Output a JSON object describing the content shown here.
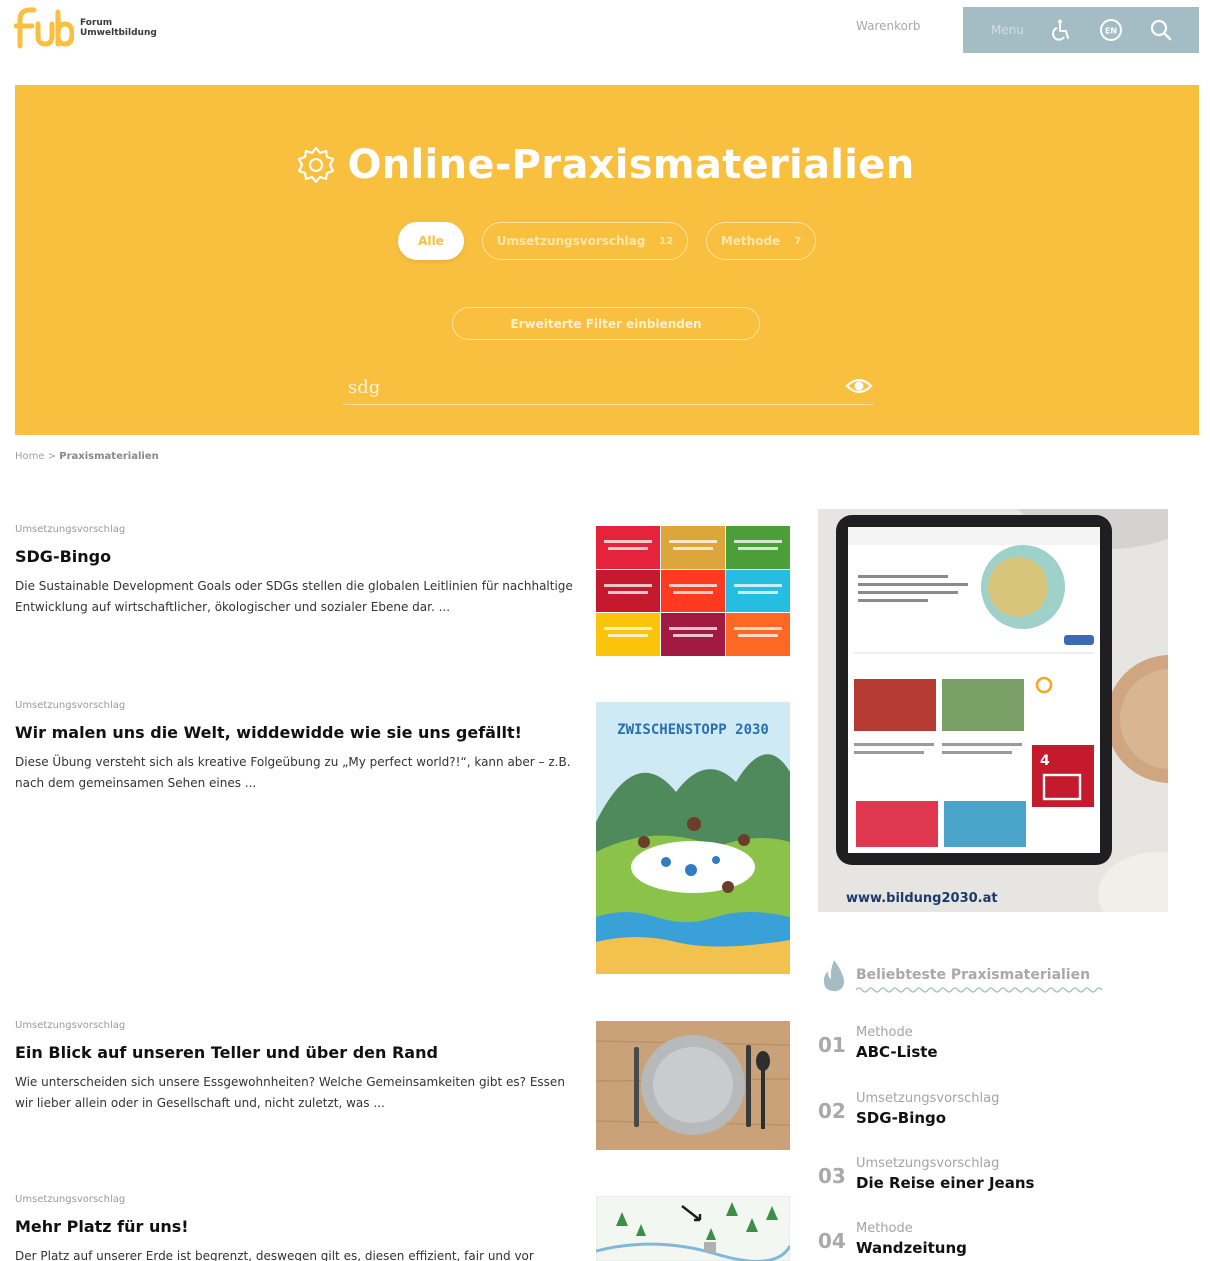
{
  "header": {
    "logo_text_line1": "Forum",
    "logo_text_line2": "Umweltbildung",
    "cart_label": "Warenkorb",
    "menu_label": "Menu",
    "accent_color": "#f9bf3f",
    "util_bar_color": "#a4bcc3"
  },
  "hero": {
    "title": "Online-Praxismaterialien",
    "tabs": [
      {
        "label": "Alle",
        "active": true
      },
      {
        "label": "Umsetzungsvorschlag",
        "count": "12"
      },
      {
        "label": "Methode",
        "count": "7"
      }
    ],
    "filter_button_label": "Erweiterte Filter einblenden",
    "search_value": "sdg"
  },
  "breadcrumb": {
    "home": "Home",
    "separator": ">",
    "current": "Praxismaterialien"
  },
  "articles": [
    {
      "category": "Umsetzungsvorschlag",
      "title": "SDG-Bingo",
      "excerpt": "Die Sustainable Development Goals oder SDGs stellen die globalen Leitlinien für nachhaltige Entwicklung auf wirtschaftlicher, ökologischer und sozialer Ebene dar. ..."
    },
    {
      "category": "Umsetzungsvorschlag",
      "title": "Wir malen uns die Welt, widdewidde wie sie uns gefällt!",
      "excerpt": "Diese Übung versteht sich als kreative Folgeübung zu „My perfect world?!“, kann aber – z.B. nach dem gemeinsamen Sehen eines ...",
      "image_text": "ZWISCHENSTOPP 2030"
    },
    {
      "category": "Umsetzungsvorschlag",
      "title": "Ein Blick auf unseren Teller und über den Rand",
      "excerpt": "Wie unterscheiden sich unsere Essgewohnheiten? Welche Gemeinsamkeiten gibt es? Essen wir lieber allein oder in Gesellschaft und, nicht zuletzt, was ..."
    },
    {
      "category": "Umsetzungsvorschlag",
      "title": "Mehr Platz für uns!",
      "excerpt": "Der Platz auf unserer Erde ist begrenzt, deswegen gilt es, diesen effizient, fair und vor"
    }
  ],
  "sidebar": {
    "promo_url": "www.bildung2030.at",
    "promo_tile_text": "4",
    "popular_title": "Beliebteste Praxismaterialien",
    "popular": [
      {
        "num": "01",
        "kind": "Methode",
        "name": "ABC-Liste"
      },
      {
        "num": "02",
        "kind": "Umsetzungsvorschlag",
        "name": "SDG-Bingo"
      },
      {
        "num": "03",
        "kind": "Umsetzungsvorschlag",
        "name": "Die Reise einer Jeans"
      },
      {
        "num": "04",
        "kind": "Methode",
        "name": "Wandzeitung"
      }
    ]
  }
}
